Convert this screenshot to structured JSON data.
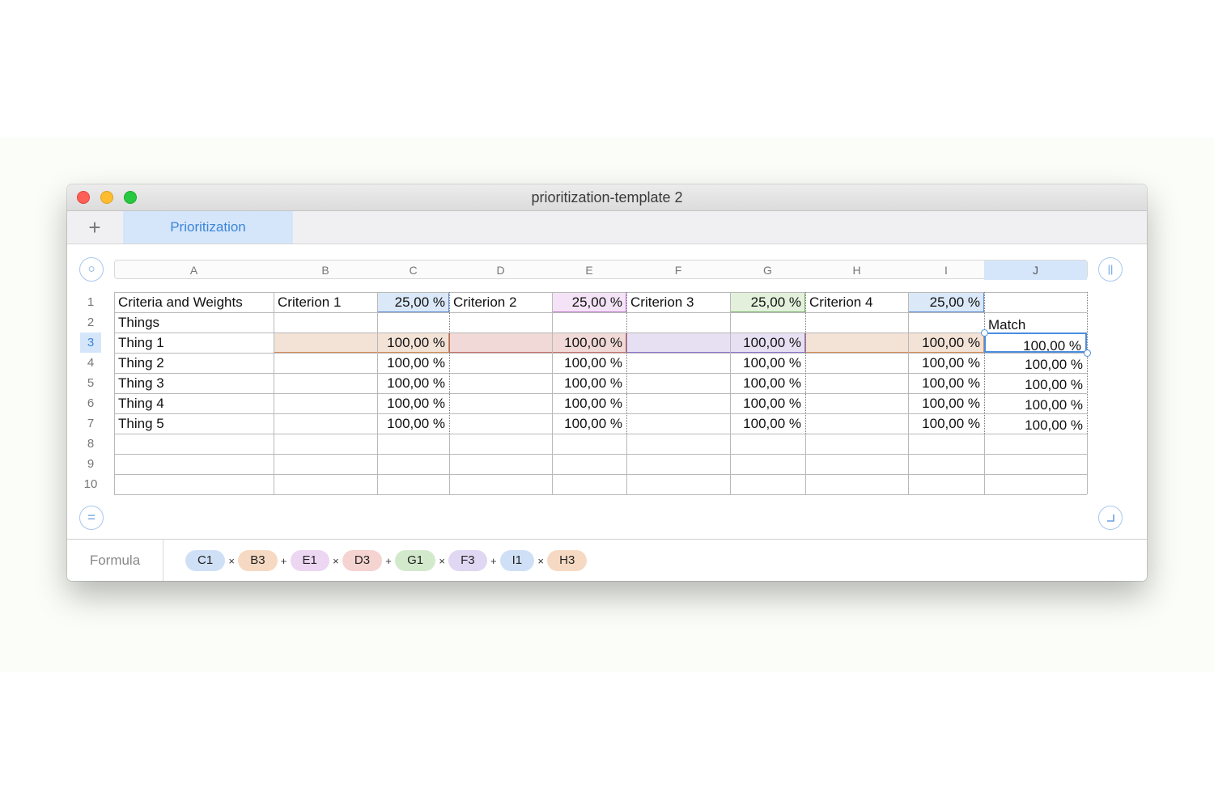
{
  "window": {
    "title": "prioritization-template 2"
  },
  "tabs": [
    {
      "label": "Prioritization"
    }
  ],
  "icons": {
    "add": "+",
    "grid_top_left": "○",
    "grid_top_right": "||",
    "grid_bottom_left": "=",
    "grid_bottom_right": "resize-corner-icon"
  },
  "columns": [
    "A",
    "B",
    "C",
    "D",
    "E",
    "F",
    "G",
    "H",
    "I",
    "J"
  ],
  "rows": [
    "1",
    "2",
    "3",
    "4",
    "5",
    "6",
    "7",
    "8",
    "9",
    "10"
  ],
  "table": {
    "row1": [
      "Criteria and Weights",
      "Criterion 1",
      "25,00 %",
      "Criterion 2",
      "25,00 %",
      "Criterion 3",
      "25,00 %",
      "Criterion 4",
      "25,00 %",
      ""
    ],
    "row2": [
      "Things",
      "",
      "",
      "",
      "",
      "",
      "",
      "",
      "",
      "Match"
    ],
    "things": [
      {
        "name": "Thing 1",
        "c1": "100,00 %",
        "c2": "100,00 %",
        "c3": "100,00 %",
        "c4": "100,00 %",
        "match": "100,00 %"
      },
      {
        "name": "Thing 2",
        "c1": "100,00 %",
        "c2": "100,00 %",
        "c3": "100,00 %",
        "c4": "100,00 %",
        "match": "100,00 %"
      },
      {
        "name": "Thing 3",
        "c1": "100,00 %",
        "c2": "100,00 %",
        "c3": "100,00 %",
        "c4": "100,00 %",
        "match": "100,00 %"
      },
      {
        "name": "Thing 4",
        "c1": "100,00 %",
        "c2": "100,00 %",
        "c3": "100,00 %",
        "c4": "100,00 %",
        "match": "100,00 %"
      },
      {
        "name": "Thing 5",
        "c1": "100,00 %",
        "c2": "100,00 %",
        "c3": "100,00 %",
        "c4": "100,00 %",
        "match": "100,00 %"
      }
    ]
  },
  "formula": {
    "label": "Formula",
    "tokens": [
      {
        "ref": "C1",
        "color": "#cfe0f6"
      },
      {
        "op": "×"
      },
      {
        "ref": "B3",
        "color": "#f6d9c2"
      },
      {
        "op": "+"
      },
      {
        "ref": "E1",
        "color": "#ecd6f2"
      },
      {
        "op": "×"
      },
      {
        "ref": "D3",
        "color": "#f4d3d0"
      },
      {
        "op": "+"
      },
      {
        "ref": "G1",
        "color": "#d3e9cc"
      },
      {
        "op": "×"
      },
      {
        "ref": "F3",
        "color": "#e0d7f3"
      },
      {
        "op": "+"
      },
      {
        "ref": "I1",
        "color": "#cfe0f6"
      },
      {
        "op": "×"
      },
      {
        "ref": "H3",
        "color": "#f6d9c2"
      }
    ]
  },
  "colors": {
    "accent": "#3c86d8",
    "c1_weight": "#dbe8f8",
    "e1_weight": "#f4e3f6",
    "g1_weight": "#e3f1dc",
    "i1_weight": "#dbe8f8",
    "b3_ref": "#f3e2d6",
    "d3_ref": "#f0d9d6",
    "f3_ref": "#e7e0f3",
    "h3_ref": "#f3e2d6"
  }
}
